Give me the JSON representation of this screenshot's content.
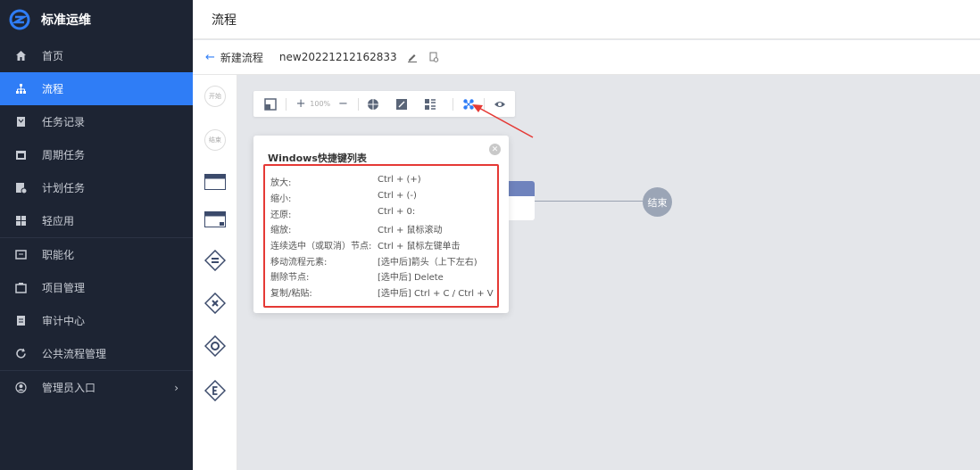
{
  "app": {
    "brand": "标准运维"
  },
  "sidebar": {
    "items": [
      {
        "label": "首页",
        "icon": "home-icon"
      },
      {
        "label": "流程",
        "icon": "flow-icon",
        "active": true
      },
      {
        "label": "任务记录",
        "icon": "task-record-icon"
      },
      {
        "label": "周期任务",
        "icon": "calendar-icon"
      },
      {
        "label": "计划任务",
        "icon": "plan-task-icon"
      },
      {
        "label": "轻应用",
        "icon": "apps-icon"
      },
      {
        "label": "职能化",
        "icon": "function-icon"
      },
      {
        "label": "项目管理",
        "icon": "project-icon"
      },
      {
        "label": "审计中心",
        "icon": "audit-icon"
      },
      {
        "label": "公共流程管理",
        "icon": "refresh-icon"
      },
      {
        "label": "管理员入口",
        "icon": "user-icon"
      }
    ]
  },
  "header": {
    "title": "流程"
  },
  "subbar": {
    "back_label": "新建流程",
    "flow_name": "new20221212162833"
  },
  "toolbar": {
    "zoom": "100%"
  },
  "palette": {
    "start": "开始",
    "end": "结束"
  },
  "canvas": {
    "end_node": "结束"
  },
  "shortcuts": {
    "title": "Windows快捷键列表",
    "rows": [
      {
        "key": "放大:",
        "value": "Ctrl + (+)"
      },
      {
        "key": "缩小:",
        "value": "Ctrl + (-)"
      },
      {
        "key": "还原:",
        "value": "Ctrl + 0:"
      },
      {
        "key": "缩放:",
        "value": "Ctrl + 鼠标滚动"
      },
      {
        "key": "连续选中（或取消）节点:",
        "value": "Ctrl + 鼠标左键单击"
      },
      {
        "key": "移动流程元素:",
        "value": "[选中后]箭头（上下左右)"
      },
      {
        "key": "删除节点:",
        "value": "[选中后] Delete"
      },
      {
        "key": "复制/粘贴:",
        "value": "[选中后] Ctrl + C / Ctrl + V"
      }
    ]
  },
  "colors": {
    "accent": "#2f7df6",
    "sidebar_bg": "#1d2433",
    "highlight": "#e53935"
  }
}
